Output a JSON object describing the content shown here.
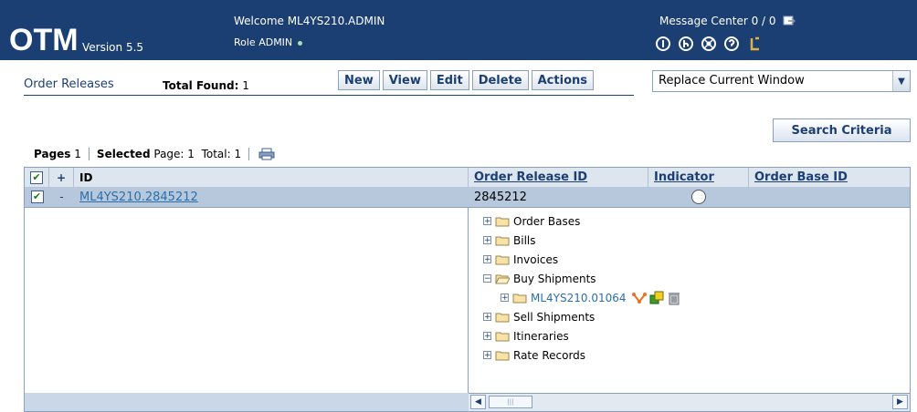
{
  "header": {
    "brand": "OTM",
    "version": "Version 5.5",
    "welcome": "Welcome ML4YS210.ADMIN",
    "role": "Role ADMIN",
    "message_center": "Message Center  0 / 0",
    "icons": [
      "info-icon",
      "back-icon",
      "help-circle-icon",
      "question-icon",
      "exit-icon"
    ],
    "background": "#1c3f73"
  },
  "toolbar": {
    "title": "Order Releases",
    "total_label": "Total Found:",
    "total_value": "1",
    "buttons": [
      "New",
      "View",
      "Edit",
      "Delete",
      "Actions"
    ],
    "window_select": "Replace Current Window"
  },
  "search_button": "Search Criteria",
  "pager": {
    "pages_label": "Pages",
    "pages_value": "1",
    "selected_label": "Selected",
    "page_label": "Page: 1",
    "total_label": "Total: 1"
  },
  "grid": {
    "columns": {
      "select": "",
      "expand": "+",
      "id": "ID",
      "order_release_id": "Order Release ID",
      "indicator": "Indicator",
      "order_base_id": "Order Base ID"
    },
    "row": {
      "checked": true,
      "expand": "-",
      "id": "ML4YS210.2845212",
      "order_release_id": "2845212"
    },
    "tree": {
      "order_bases": "Order Bases",
      "bills": "Bills",
      "invoices": "Invoices",
      "buy_shipments": "Buy Shipments",
      "shipment_id": "ML4YS210.01064",
      "sell_shipments": "Sell Shipments",
      "itineraries": "Itineraries",
      "rate_records": "Rate Records"
    }
  }
}
